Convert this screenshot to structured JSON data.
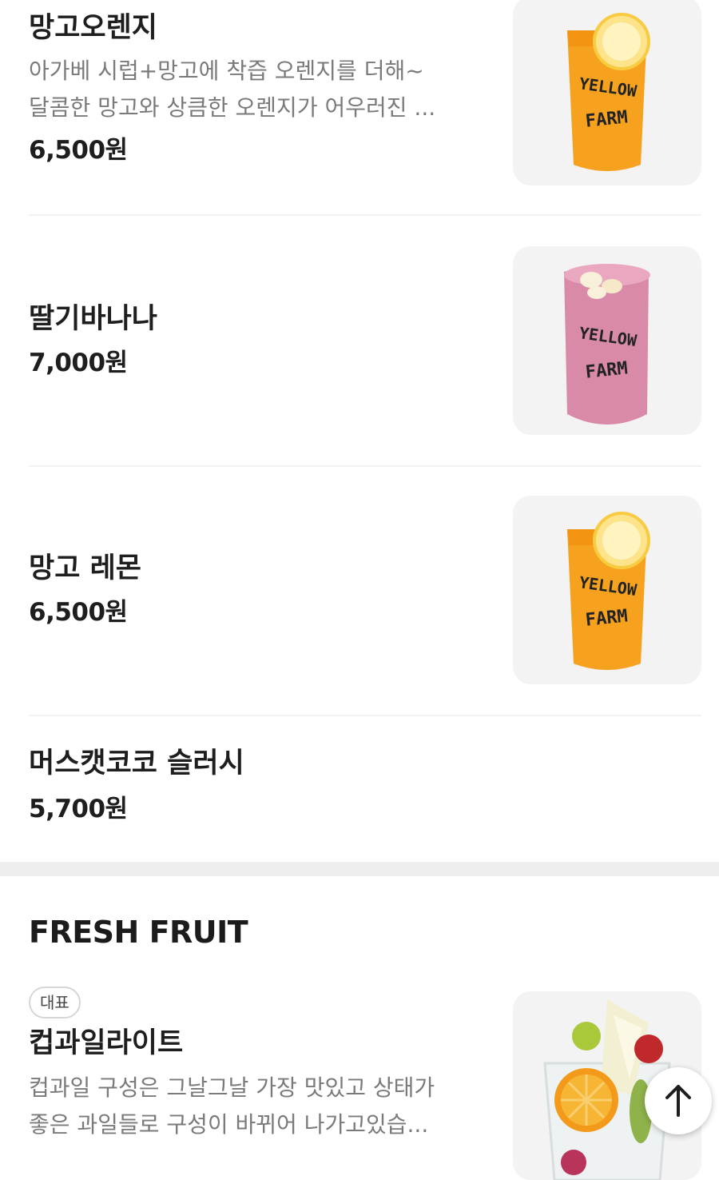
{
  "menu_items": [
    {
      "name": "망고오렌지",
      "desc_lines": [
        "아가베 시럽+망고에 착즙 오렌지를 더해~",
        "달콤한 망고와 상큼한 오렌지가 어우러진 ..."
      ],
      "price": "6,500원",
      "image": "mango-orange-drink"
    },
    {
      "name": "딸기바나나",
      "price": "7,000원",
      "image": "strawberry-banana-drink"
    },
    {
      "name": "망고 레몬",
      "price": "6,500원",
      "image": "mango-lemon-drink"
    },
    {
      "name": "머스캣코코 슬러시",
      "price": "5,700원"
    }
  ],
  "section": {
    "title": "FRESH FRUIT",
    "items": [
      {
        "badge": "대표",
        "name": "컵과일라이트",
        "desc_lines": [
          "컵과일 구성은 그날그날 가장 맛있고 상태가",
          "좋은 과일들로 구성이 바뀌어 나가고있습..."
        ],
        "image": "cup-fruit"
      }
    ]
  },
  "cup_brand": [
    "YELLOW",
    "FARM"
  ],
  "scroll_top_icon": "arrow-up-icon",
  "colors": {
    "orange_drink": "#f5a623",
    "pink_drink": "#d98aa8",
    "divider": "#f2f2f2"
  }
}
